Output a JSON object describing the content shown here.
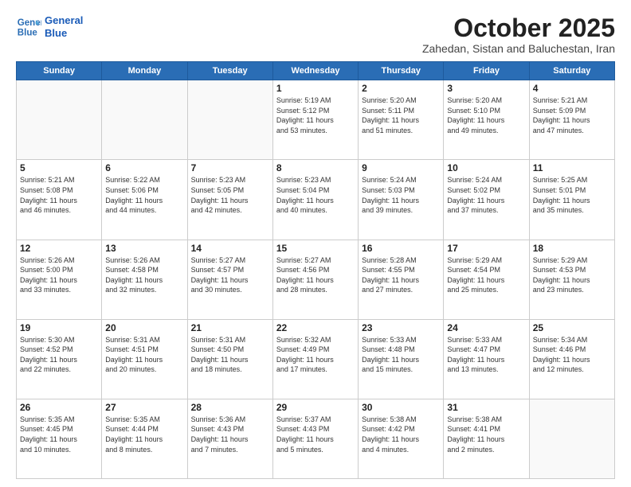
{
  "logo": {
    "line1": "General",
    "line2": "Blue"
  },
  "title": "October 2025",
  "location": "Zahedan, Sistan and Baluchestan, Iran",
  "days_header": [
    "Sunday",
    "Monday",
    "Tuesday",
    "Wednesday",
    "Thursday",
    "Friday",
    "Saturday"
  ],
  "weeks": [
    [
      {
        "num": "",
        "info": ""
      },
      {
        "num": "",
        "info": ""
      },
      {
        "num": "",
        "info": ""
      },
      {
        "num": "1",
        "info": "Sunrise: 5:19 AM\nSunset: 5:12 PM\nDaylight: 11 hours\nand 53 minutes."
      },
      {
        "num": "2",
        "info": "Sunrise: 5:20 AM\nSunset: 5:11 PM\nDaylight: 11 hours\nand 51 minutes."
      },
      {
        "num": "3",
        "info": "Sunrise: 5:20 AM\nSunset: 5:10 PM\nDaylight: 11 hours\nand 49 minutes."
      },
      {
        "num": "4",
        "info": "Sunrise: 5:21 AM\nSunset: 5:09 PM\nDaylight: 11 hours\nand 47 minutes."
      }
    ],
    [
      {
        "num": "5",
        "info": "Sunrise: 5:21 AM\nSunset: 5:08 PM\nDaylight: 11 hours\nand 46 minutes."
      },
      {
        "num": "6",
        "info": "Sunrise: 5:22 AM\nSunset: 5:06 PM\nDaylight: 11 hours\nand 44 minutes."
      },
      {
        "num": "7",
        "info": "Sunrise: 5:23 AM\nSunset: 5:05 PM\nDaylight: 11 hours\nand 42 minutes."
      },
      {
        "num": "8",
        "info": "Sunrise: 5:23 AM\nSunset: 5:04 PM\nDaylight: 11 hours\nand 40 minutes."
      },
      {
        "num": "9",
        "info": "Sunrise: 5:24 AM\nSunset: 5:03 PM\nDaylight: 11 hours\nand 39 minutes."
      },
      {
        "num": "10",
        "info": "Sunrise: 5:24 AM\nSunset: 5:02 PM\nDaylight: 11 hours\nand 37 minutes."
      },
      {
        "num": "11",
        "info": "Sunrise: 5:25 AM\nSunset: 5:01 PM\nDaylight: 11 hours\nand 35 minutes."
      }
    ],
    [
      {
        "num": "12",
        "info": "Sunrise: 5:26 AM\nSunset: 5:00 PM\nDaylight: 11 hours\nand 33 minutes."
      },
      {
        "num": "13",
        "info": "Sunrise: 5:26 AM\nSunset: 4:58 PM\nDaylight: 11 hours\nand 32 minutes."
      },
      {
        "num": "14",
        "info": "Sunrise: 5:27 AM\nSunset: 4:57 PM\nDaylight: 11 hours\nand 30 minutes."
      },
      {
        "num": "15",
        "info": "Sunrise: 5:27 AM\nSunset: 4:56 PM\nDaylight: 11 hours\nand 28 minutes."
      },
      {
        "num": "16",
        "info": "Sunrise: 5:28 AM\nSunset: 4:55 PM\nDaylight: 11 hours\nand 27 minutes."
      },
      {
        "num": "17",
        "info": "Sunrise: 5:29 AM\nSunset: 4:54 PM\nDaylight: 11 hours\nand 25 minutes."
      },
      {
        "num": "18",
        "info": "Sunrise: 5:29 AM\nSunset: 4:53 PM\nDaylight: 11 hours\nand 23 minutes."
      }
    ],
    [
      {
        "num": "19",
        "info": "Sunrise: 5:30 AM\nSunset: 4:52 PM\nDaylight: 11 hours\nand 22 minutes."
      },
      {
        "num": "20",
        "info": "Sunrise: 5:31 AM\nSunset: 4:51 PM\nDaylight: 11 hours\nand 20 minutes."
      },
      {
        "num": "21",
        "info": "Sunrise: 5:31 AM\nSunset: 4:50 PM\nDaylight: 11 hours\nand 18 minutes."
      },
      {
        "num": "22",
        "info": "Sunrise: 5:32 AM\nSunset: 4:49 PM\nDaylight: 11 hours\nand 17 minutes."
      },
      {
        "num": "23",
        "info": "Sunrise: 5:33 AM\nSunset: 4:48 PM\nDaylight: 11 hours\nand 15 minutes."
      },
      {
        "num": "24",
        "info": "Sunrise: 5:33 AM\nSunset: 4:47 PM\nDaylight: 11 hours\nand 13 minutes."
      },
      {
        "num": "25",
        "info": "Sunrise: 5:34 AM\nSunset: 4:46 PM\nDaylight: 11 hours\nand 12 minutes."
      }
    ],
    [
      {
        "num": "26",
        "info": "Sunrise: 5:35 AM\nSunset: 4:45 PM\nDaylight: 11 hours\nand 10 minutes."
      },
      {
        "num": "27",
        "info": "Sunrise: 5:35 AM\nSunset: 4:44 PM\nDaylight: 11 hours\nand 8 minutes."
      },
      {
        "num": "28",
        "info": "Sunrise: 5:36 AM\nSunset: 4:43 PM\nDaylight: 11 hours\nand 7 minutes."
      },
      {
        "num": "29",
        "info": "Sunrise: 5:37 AM\nSunset: 4:43 PM\nDaylight: 11 hours\nand 5 minutes."
      },
      {
        "num": "30",
        "info": "Sunrise: 5:38 AM\nSunset: 4:42 PM\nDaylight: 11 hours\nand 4 minutes."
      },
      {
        "num": "31",
        "info": "Sunrise: 5:38 AM\nSunset: 4:41 PM\nDaylight: 11 hours\nand 2 minutes."
      },
      {
        "num": "",
        "info": ""
      }
    ]
  ]
}
